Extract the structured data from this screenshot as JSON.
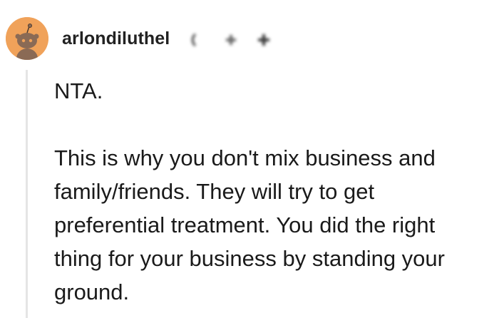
{
  "comment": {
    "author": {
      "username": "arlondiluthel",
      "avatar_icon": "snoo-avatar-icon",
      "avatar_color": "#f0a25a",
      "badges": [
        "award-icon",
        "award-icon",
        "award-icon"
      ]
    },
    "body": {
      "verdict": "NTA.",
      "text": "This is why you don't mix business and family/friends. They will try to get preferential treatment. You did the right thing for your business by standing your ground."
    }
  }
}
